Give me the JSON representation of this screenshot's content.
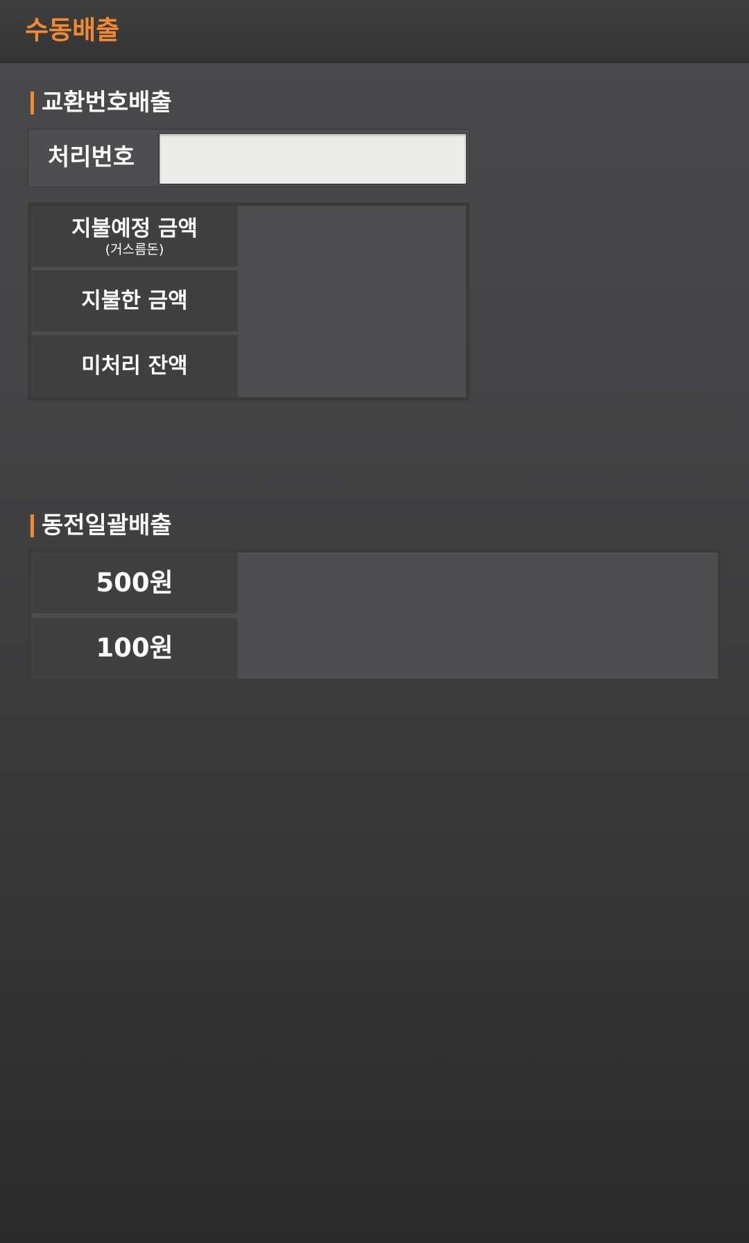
{
  "header": {
    "title": "수동배출"
  },
  "exchange_section": {
    "title": "교환번호배출",
    "process_number_label": "처리번호",
    "process_number_value": "",
    "rows": [
      {
        "label": "지불예정 금액",
        "sublabel": "(거스름돈)",
        "value": ""
      },
      {
        "label": "지불한 금액",
        "value": ""
      },
      {
        "label": "미처리 잔액",
        "value": ""
      }
    ]
  },
  "coin_section": {
    "title": "동전일괄배출",
    "buttons": [
      {
        "label": "500원"
      },
      {
        "label": "100원"
      }
    ]
  },
  "colors": {
    "accent": "#f08a33",
    "background": "#444446",
    "cell": "#404041",
    "panel": "#4e4e50",
    "input": "#ebebe9"
  }
}
